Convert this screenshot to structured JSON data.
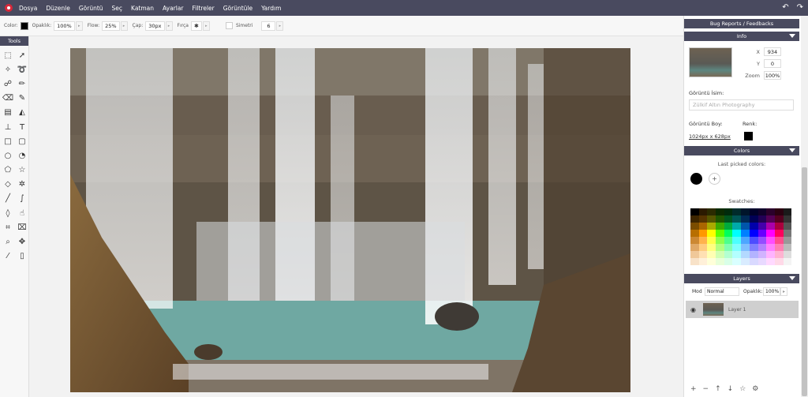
{
  "menubar": {
    "items": [
      "Dosya",
      "Düzenle",
      "Görüntü",
      "Seç",
      "Katman",
      "Ayarlar",
      "Filtreler",
      "Görüntüle",
      "Yardım"
    ],
    "undo_icon": "undo-icon",
    "redo_icon": "redo-icon"
  },
  "options": {
    "color_label": "Color:",
    "color_value": "#000000",
    "opacity_label": "Opaklık:",
    "opacity_value": "100%",
    "flow_label": "Flow:",
    "flow_value": "25%",
    "cap_label": "Çap:",
    "cap_value": "30px",
    "brush_label": "Fırça",
    "symmetry_label": "Simetri",
    "symmetry_value": "6"
  },
  "tools": {
    "title": "Tools",
    "items": [
      "select-rect",
      "move",
      "magic-wand",
      "lasso",
      "blur",
      "brush",
      "eraser",
      "pencil",
      "gradient",
      "fill",
      "stamp",
      "text",
      "rectangle",
      "rounded-rect",
      "ellipse",
      "shape",
      "polygon",
      "star",
      "fill-shape",
      "settings",
      "line",
      "curve",
      "drop",
      "smudge",
      "crop",
      "crop-alt",
      "zoom",
      "pan",
      "picker",
      "trash"
    ]
  },
  "right_panel": {
    "bug_reports": "Bug Reports / Feedbacks",
    "info": {
      "title": "Info",
      "x_label": "X",
      "x_value": "934",
      "y_label": "Y",
      "y_value": "0",
      "zoom_label": "Zoom",
      "zoom_value": "100%",
      "name_label": "Görüntü İsim:",
      "name_placeholder": "Zülkif Altın Photography",
      "size_label": "Görüntü Boy:",
      "size_value": "1024px x 628px",
      "color_label": "Renk:"
    },
    "colors": {
      "title": "Colors",
      "last_picked": "Last picked colors:",
      "add": "+",
      "swatches_title": "Swatches:"
    },
    "layers": {
      "title": "Layers",
      "mode_label": "Mod",
      "mode_value": "Normal",
      "opacity_label": "Opaklık:",
      "opacity_value": "100%",
      "layer_name": "Layer 1"
    }
  },
  "swatch_colors": [
    "#000000",
    "#2b1a00",
    "#2b2b00",
    "#0b2b00",
    "#002b0b",
    "#002b2b",
    "#00152b",
    "#00002b",
    "#10002b",
    "#2b002b",
    "#2b0010",
    "#1a1a1a",
    "#3d2600",
    "#553300",
    "#555500",
    "#1f5500",
    "#00551f",
    "#005555",
    "#002a55",
    "#000055",
    "#220055",
    "#550055",
    "#55001f",
    "#333333",
    "#7a4c00",
    "#aa6600",
    "#aaaa00",
    "#3daa00",
    "#00aa3d",
    "#00aaaa",
    "#0055aa",
    "#0000aa",
    "#4400aa",
    "#aa00aa",
    "#aa003d",
    "#555555",
    "#b86f00",
    "#ff9900",
    "#ffff00",
    "#5cff00",
    "#00ff5c",
    "#00ffff",
    "#0080ff",
    "#0000ff",
    "#6600ff",
    "#ff00ff",
    "#ff005c",
    "#777777",
    "#cc8833",
    "#ffb24d",
    "#ffff4d",
    "#8dff4d",
    "#4dff8d",
    "#4dffff",
    "#4da6ff",
    "#4d4dff",
    "#944dff",
    "#ff4dff",
    "#ff4d8d",
    "#999999",
    "#e0a866",
    "#ffcc80",
    "#ffff80",
    "#b3ff80",
    "#80ffb3",
    "#80ffff",
    "#80bfff",
    "#8080ff",
    "#b380ff",
    "#ff80ff",
    "#ff80b3",
    "#bbbbbb",
    "#f0c899",
    "#ffe0b3",
    "#ffffb3",
    "#d1ffb3",
    "#b3ffd1",
    "#b3ffff",
    "#b3d9ff",
    "#b3b3ff",
    "#d1b3ff",
    "#ffb3ff",
    "#ffb3d1",
    "#dddddd",
    "#f8e2c8",
    "#fff0d9",
    "#ffffd9",
    "#e8ffd9",
    "#d9ffe8",
    "#d9ffff",
    "#d9ecff",
    "#d9d9ff",
    "#e8d9ff",
    "#ffd9ff",
    "#ffd9e8",
    "#f4f4f4"
  ]
}
